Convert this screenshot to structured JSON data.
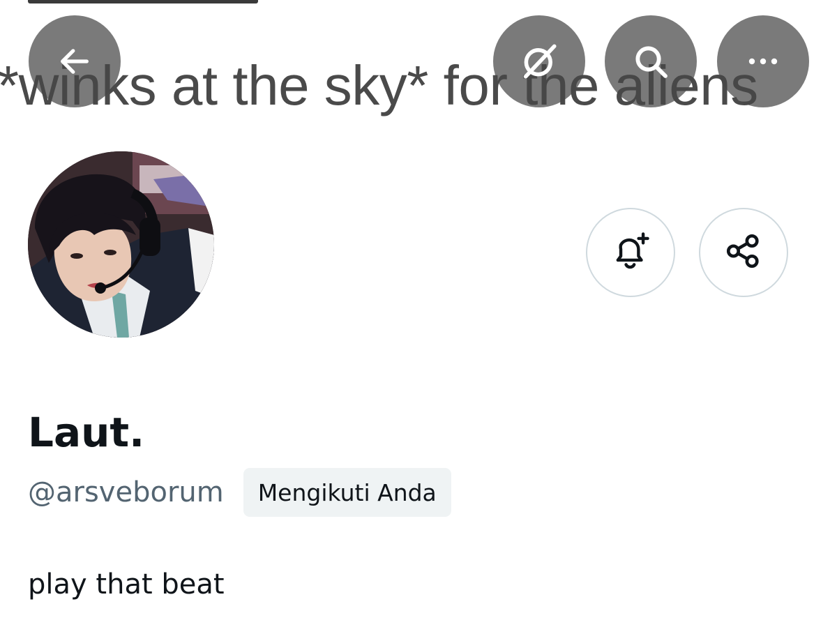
{
  "banner": {
    "text": "*winks at the sky* for the aliens"
  },
  "header": {
    "back_icon": "arrow-left-icon",
    "grok_icon": "slashed-circle-icon",
    "search_icon": "search-icon",
    "more_icon": "more-horizontal-icon",
    "button_color": "#464646"
  },
  "profile": {
    "avatar_icon": "profile-photo",
    "display_name": "Laut.",
    "handle": "@arsveborum",
    "follows_you_badge": "Mengikuti Anda",
    "bio": "play that beat"
  },
  "actions": {
    "notify_icon": "bell-plus-icon",
    "share_icon": "share-icon",
    "border_color": "#cfd9de"
  },
  "colors": {
    "text_primary": "#0f1419",
    "text_secondary": "#536471",
    "badge_bg": "#eff3f4"
  }
}
